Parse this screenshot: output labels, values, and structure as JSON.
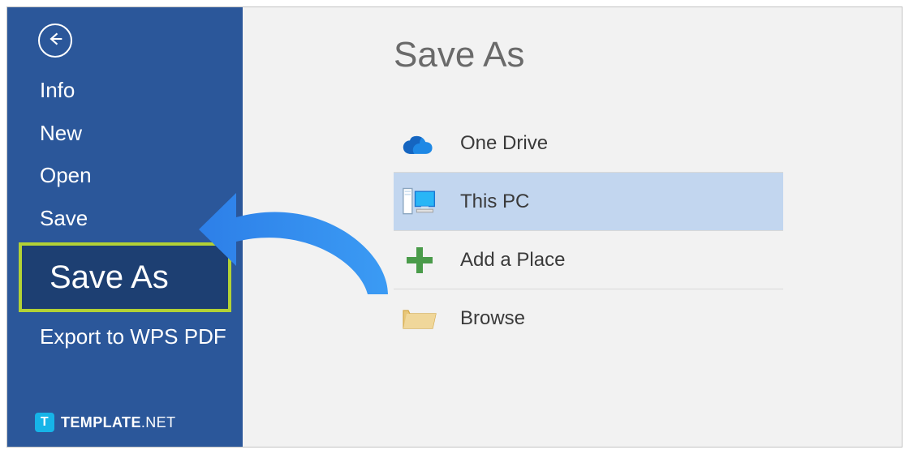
{
  "sidebar": {
    "items": [
      {
        "label": "Info"
      },
      {
        "label": "New"
      },
      {
        "label": "Open"
      },
      {
        "label": "Save"
      },
      {
        "label": "Save As",
        "active": true
      },
      {
        "label": "Export to WPS PDF"
      }
    ],
    "branding": {
      "prefix": "TEMPLATE",
      "suffix": ".NET",
      "badge": "T"
    }
  },
  "main": {
    "title": "Save As",
    "locations": [
      {
        "label": "One Drive",
        "icon": "onedrive"
      },
      {
        "label": "This PC",
        "icon": "thispc",
        "selected": true
      },
      {
        "label": "Add a Place",
        "icon": "addplace"
      },
      {
        "label": "Browse",
        "icon": "browse"
      }
    ]
  }
}
